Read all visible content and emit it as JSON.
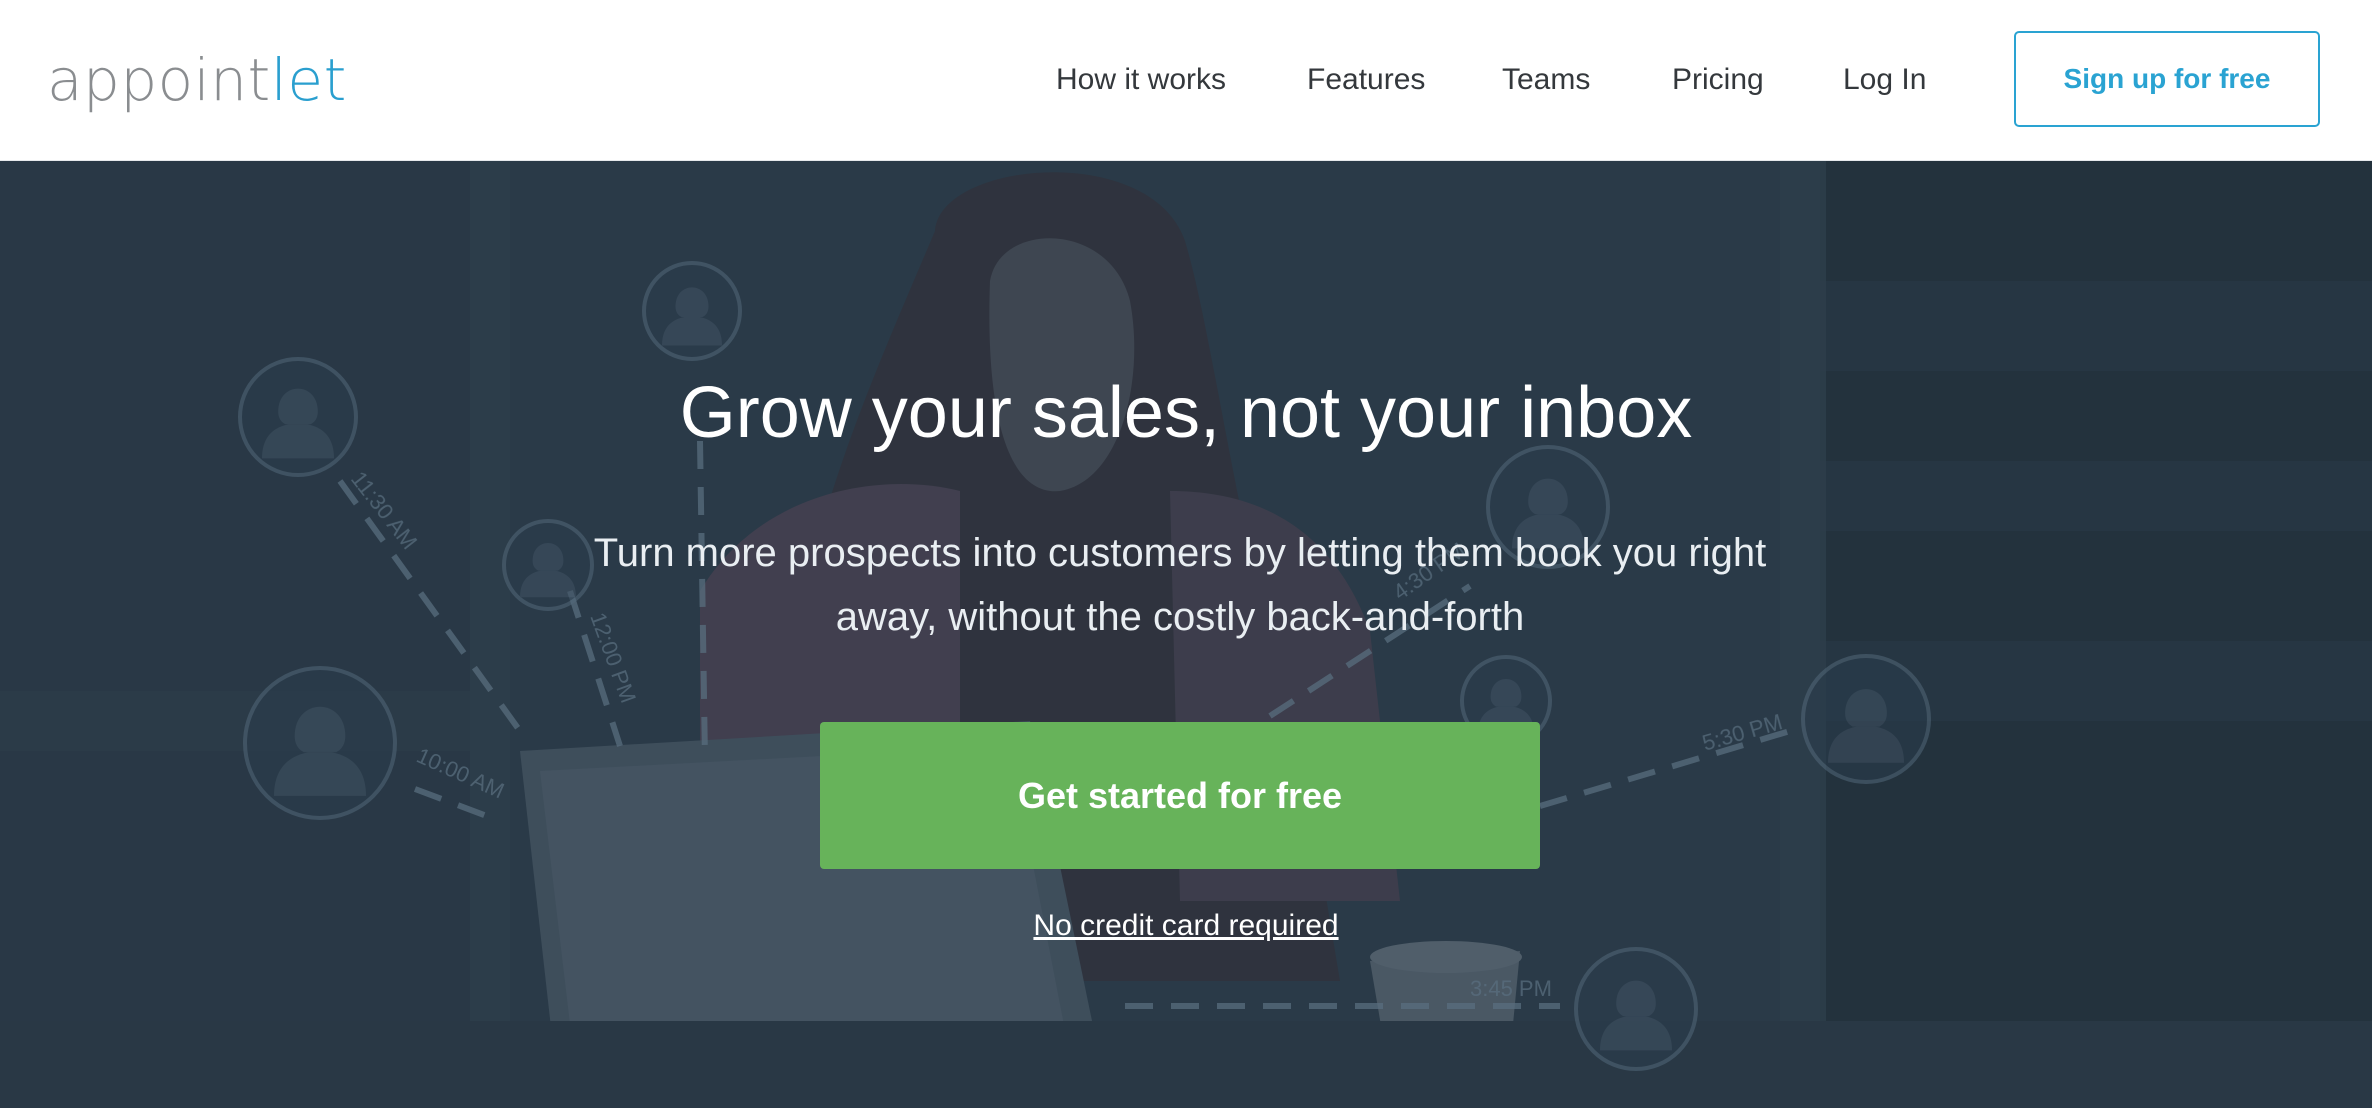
{
  "header": {
    "logo": {
      "part1": "appoint",
      "part2": "let"
    },
    "nav": [
      {
        "label": "How it works"
      },
      {
        "label": "Features"
      },
      {
        "label": "Teams"
      },
      {
        "label": "Pricing"
      },
      {
        "label": "Log In"
      }
    ],
    "signup_label": "Sign up for free"
  },
  "hero": {
    "title": "Grow your sales, not your inbox",
    "subtitle": "Turn more prospects into customers by letting them book you right away, without the costly back-and-forth",
    "cta_label": "Get started for free",
    "note": "No credit card required",
    "diagram_times": [
      "11:30 AM",
      "12:00 PM",
      "10:00 AM",
      "4:30 PM",
      "5:30 PM",
      "3:45 PM"
    ]
  },
  "colors": {
    "brand_blue": "#2a9fcf",
    "cta_green": "#67b35a",
    "hero_overlay": "#2c3c4a"
  },
  "icons": [
    "user-avatar-icon"
  ]
}
